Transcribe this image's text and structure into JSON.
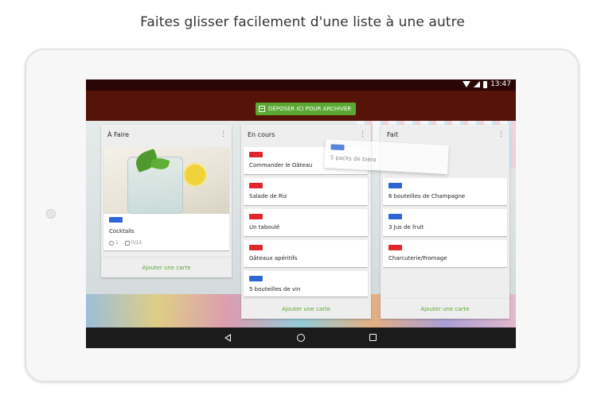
{
  "headline": "Faites glisser facilement d'une liste à une autre",
  "status_bar": {
    "time": "13:47",
    "icons": [
      "wifi-icon",
      "signal-icon",
      "battery-icon"
    ]
  },
  "archive_drop": {
    "label": "DÉPOSER ICI POUR ARCHIVER",
    "icon": "archive-icon"
  },
  "colors": {
    "label_blue": "#2d66d2",
    "label_red": "#e0262c",
    "accent_green": "#5aa832",
    "topbar": "#551407"
  },
  "lists": [
    {
      "title": "À Faire",
      "cards": [
        {
          "title": "Cocktails",
          "label": "blue",
          "attachments": "1",
          "checklist": "0/15",
          "cover": "lemonade-photo"
        }
      ],
      "add_label": "Ajouter une carte"
    },
    {
      "title": "En cours",
      "cards": [
        {
          "title": "Commander le Gâteau",
          "label": "red"
        },
        {
          "title": "Salade de Riz",
          "label": "red"
        },
        {
          "title": "Un taboulé",
          "label": "red"
        },
        {
          "title": "Gâteaux apéritifs",
          "label": "red"
        },
        {
          "title": "5 bouteilles de vin",
          "label": "blue"
        }
      ],
      "add_label": "Ajouter une carte"
    },
    {
      "title": "Fait",
      "cards": [
        {
          "title": "6 bouteilles de Champagne",
          "label": "blue"
        },
        {
          "title": "3 Jus de fruit",
          "label": "blue"
        },
        {
          "title": "Charcuterie/Fromage",
          "label": "red"
        }
      ],
      "add_label": "Ajouter une carte"
    }
  ],
  "dragging_card": {
    "title": "5 packs de bière",
    "label": "blue"
  },
  "nav": {
    "icons": [
      "back-icon",
      "home-icon",
      "recent-apps-icon"
    ]
  }
}
